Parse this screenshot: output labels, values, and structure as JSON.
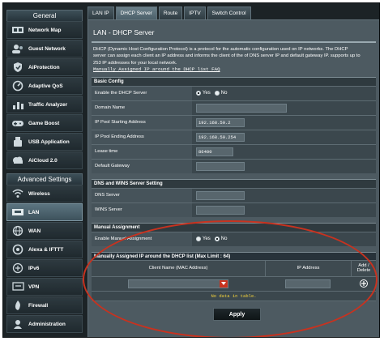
{
  "sidebar": {
    "general_label": "General",
    "general_items": [
      {
        "label": "Network Map",
        "icon": "network-map-icon"
      },
      {
        "label": "Guest Network",
        "icon": "guest-network-icon"
      },
      {
        "label": "AiProtection",
        "icon": "shield-icon"
      },
      {
        "label": "Adaptive QoS",
        "icon": "qos-icon"
      },
      {
        "label": "Traffic Analyzer",
        "icon": "traffic-analyzer-icon"
      },
      {
        "label": "Game Boost",
        "icon": "gamepad-icon"
      },
      {
        "label": "USB Application",
        "icon": "usb-icon"
      },
      {
        "label": "AiCloud 2.0",
        "icon": "cloud-icon"
      }
    ],
    "advanced_label": "Advanced Settings",
    "advanced_items": [
      {
        "label": "Wireless",
        "icon": "wireless-icon"
      },
      {
        "label": "LAN",
        "icon": "lan-icon",
        "active": true
      },
      {
        "label": "WAN",
        "icon": "globe-icon"
      },
      {
        "label": "Alexa & IFTTT",
        "icon": "alexa-icon"
      },
      {
        "label": "IPv6",
        "icon": "ipv6-icon"
      },
      {
        "label": "VPN",
        "icon": "vpn-icon"
      },
      {
        "label": "Firewall",
        "icon": "firewall-icon"
      },
      {
        "label": "Administration",
        "icon": "administration-icon"
      }
    ]
  },
  "tabs": [
    "LAN IP",
    "DHCP Server",
    "Route",
    "IPTV",
    "Switch Control"
  ],
  "active_tab": "DHCP Server",
  "page": {
    "title": "LAN - DHCP Server",
    "desc1": "DHCP (Dynamic Host Configuration Protocol) is a protocol for the automatic configuration used on IP networks. The DHCP",
    "desc2": "server can assign each client an IP address and informs the client of the of DNS server IP and default gateway IP. supports up to",
    "desc3": "253 IP addresses for your local network.",
    "faq_link": "Manually Assigned IP around the DHCP list FAQ"
  },
  "basic": {
    "header": "Basic Config",
    "enable_label": "Enable the DHCP Server",
    "yes": "Yes",
    "no": "No",
    "domain_label": "Domain Name",
    "domain_value": "",
    "start_label": "IP Pool Starting Address",
    "start_value": "192.168.50.2",
    "end_label": "IP Pool Ending Address",
    "end_value": "192.168.50.254",
    "lease_label": "Lease time",
    "lease_value": "86400",
    "gateway_label": "Default Gateway",
    "gateway_value": ""
  },
  "dns": {
    "header": "DNS and WINS Server Setting",
    "dns_label": "DNS Server",
    "wins_label": "WINS Server"
  },
  "manual": {
    "header": "Manual Assignment",
    "enable_label": "Enable Manual Assignment",
    "yes": "Yes",
    "no": "No"
  },
  "list": {
    "header": "Manually Assigned IP around the DHCP list (Max Limit : 64)",
    "col_client": "Client Name (MAC Address)",
    "col_ip": "IP Address",
    "col_add1": "Add /",
    "col_add2": "Delete",
    "no_data": "No data in table."
  },
  "apply_label": "Apply",
  "colors": {
    "annotation": "#c8321f",
    "no_data_text": "#f3d23c"
  }
}
